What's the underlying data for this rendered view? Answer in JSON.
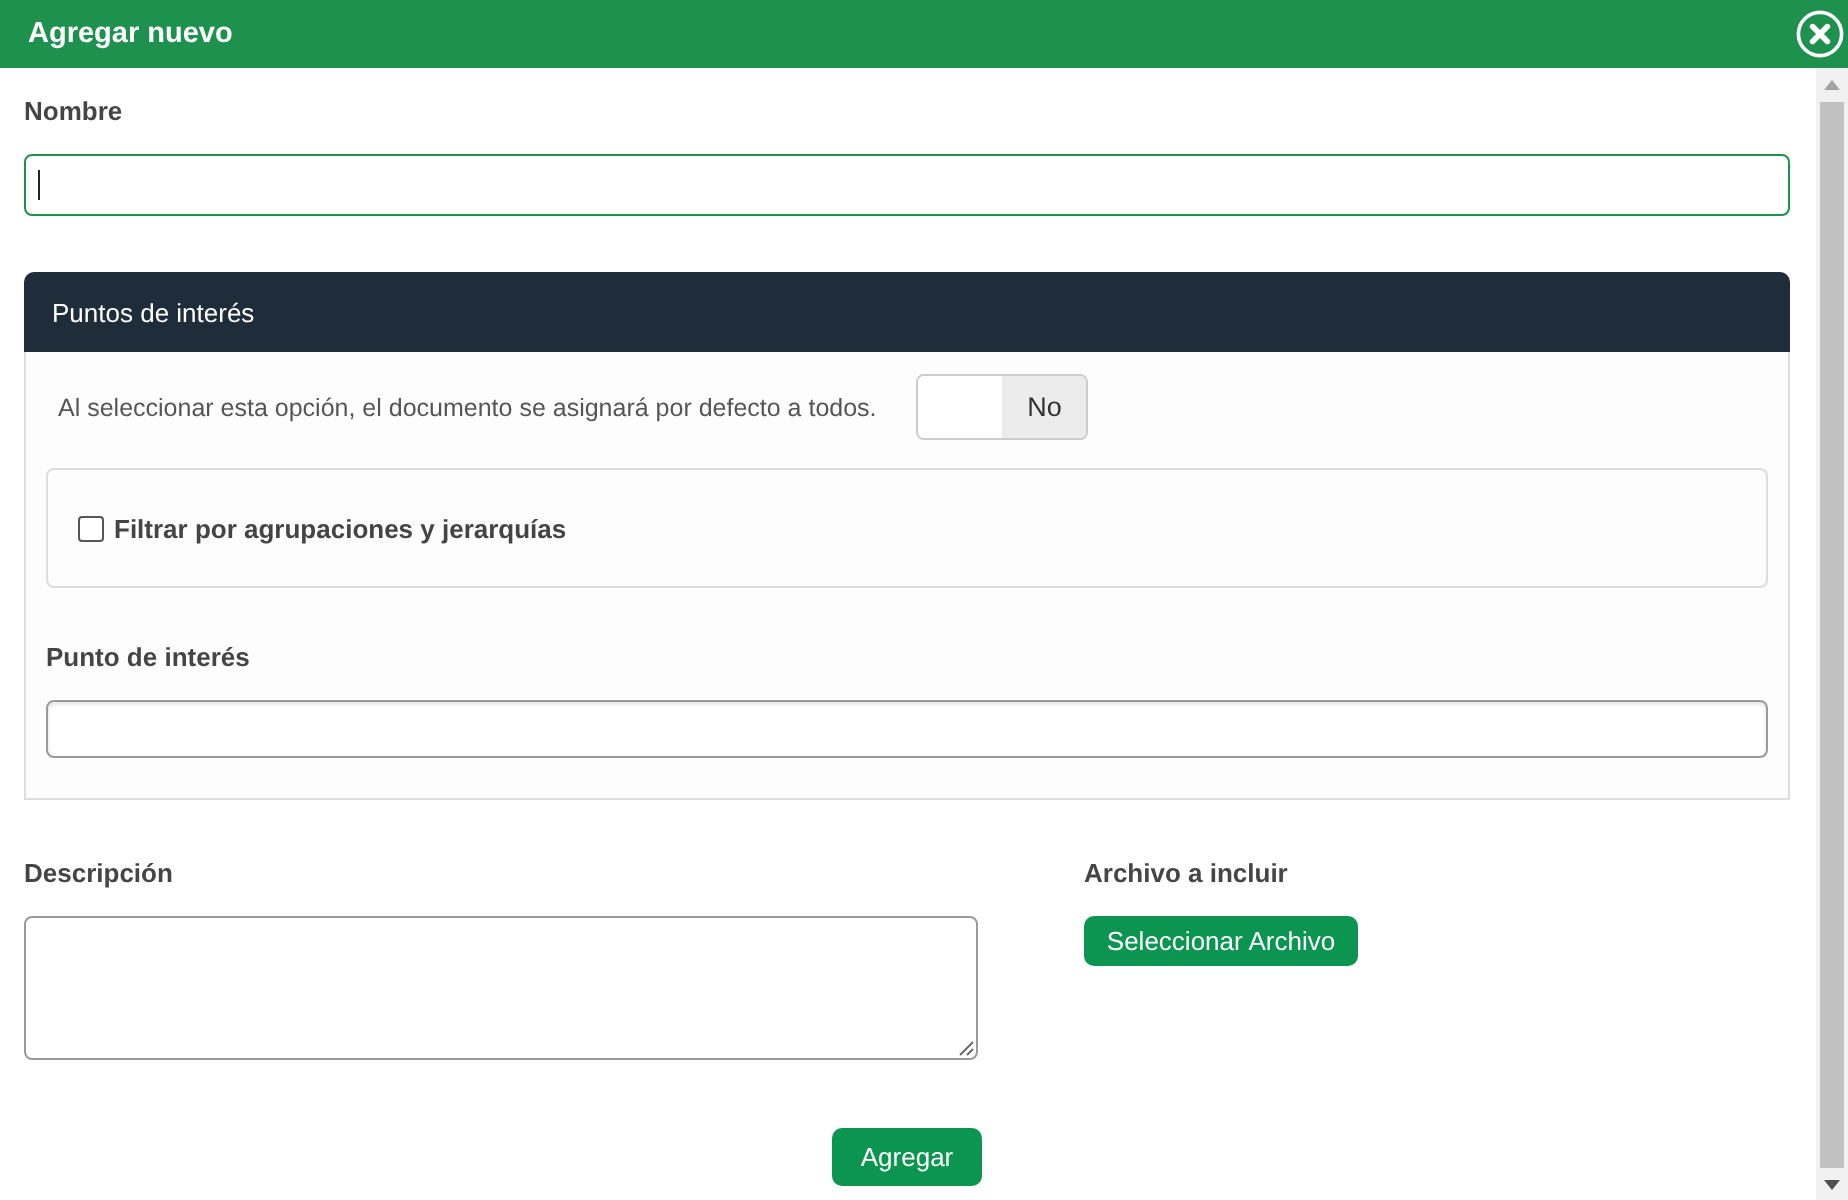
{
  "dialog": {
    "title": "Agregar nuevo"
  },
  "name_field": {
    "label": "Nombre",
    "focused": true
  },
  "panel": {
    "title": "Puntos de interés",
    "assign_all": {
      "description": "Al seleccionar esta opción, el documento se asignará por defecto a todos.",
      "toggle": {
        "label": "No",
        "on": false
      }
    },
    "filter": {
      "label": "Filtrar por agrupaciones y jerarquías",
      "checked": false
    },
    "point_field": {
      "label": "Punto de interés"
    }
  },
  "description_field": {
    "label": "Descripción"
  },
  "attachment": {
    "label": "Archivo a incluir",
    "button": "Seleccionar Archivo"
  },
  "submit_button": "Agregar"
}
